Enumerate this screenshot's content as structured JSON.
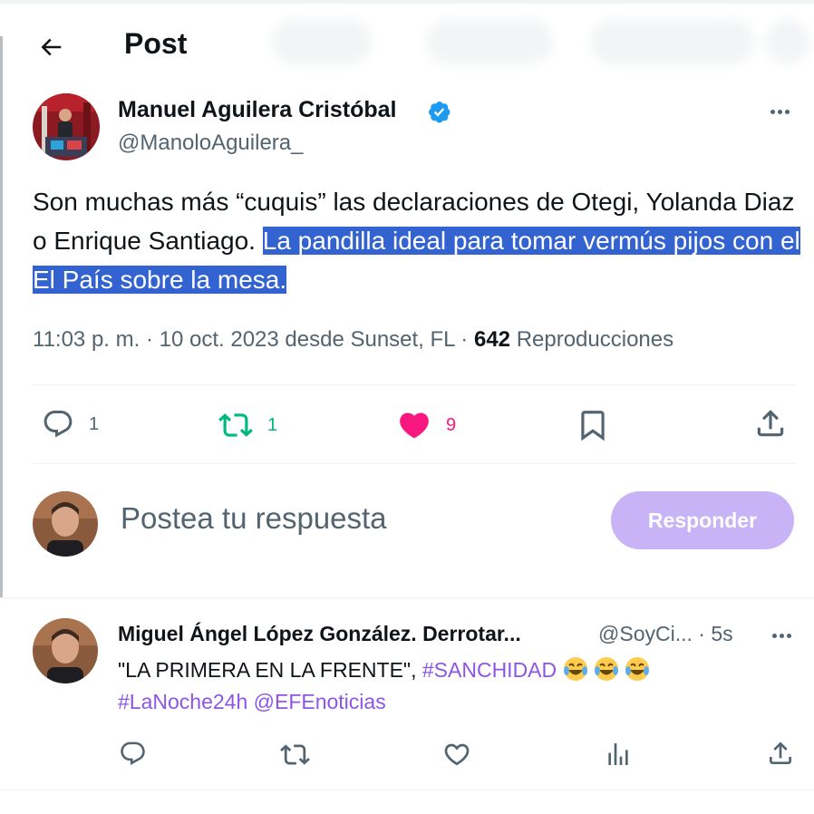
{
  "header": {
    "title": "Post",
    "back_label": "Back"
  },
  "post": {
    "author_name": "Manuel Aguilera Cristóbal",
    "author_handle": "@ManoloAguilera_",
    "text_plain": "Son muchas más “cuquis” las declaraciones de Otegi, Yolanda Diaz o Enrique Santiago.",
    "text_selected": "La pandilla ideal para tomar vermús pijos con el El País sobre la mesa.",
    "time": "11:03 p. m.",
    "date": "10 oct. 2023",
    "source": "desde Sunset, FL",
    "views_count": "642",
    "views_label": "Reproducciones",
    "replies": "1",
    "reposts": "1",
    "likes": "9"
  },
  "composer": {
    "placeholder": "Postea tu respuesta",
    "submit_label": "Responder"
  },
  "reply": {
    "author_name": "Miguel Ángel López González. Derrotar...",
    "author_handle": "@SoyCi...",
    "time": "· 5s",
    "text_quote": "\"LA PRIMERA EN LA FRENTE\",",
    "hashtag1": "#SANCHIDAD",
    "hashtag2": "#LaNoche24h",
    "mention": "@EFEnoticias"
  },
  "colors": {
    "accent_disabled": "#c7b3f5",
    "selection": "#3363d0",
    "repost_green": "#00ba7c",
    "like_pink": "#f91880",
    "link_purple": "#8d55e7",
    "verified_blue": "#1d9bf0"
  }
}
